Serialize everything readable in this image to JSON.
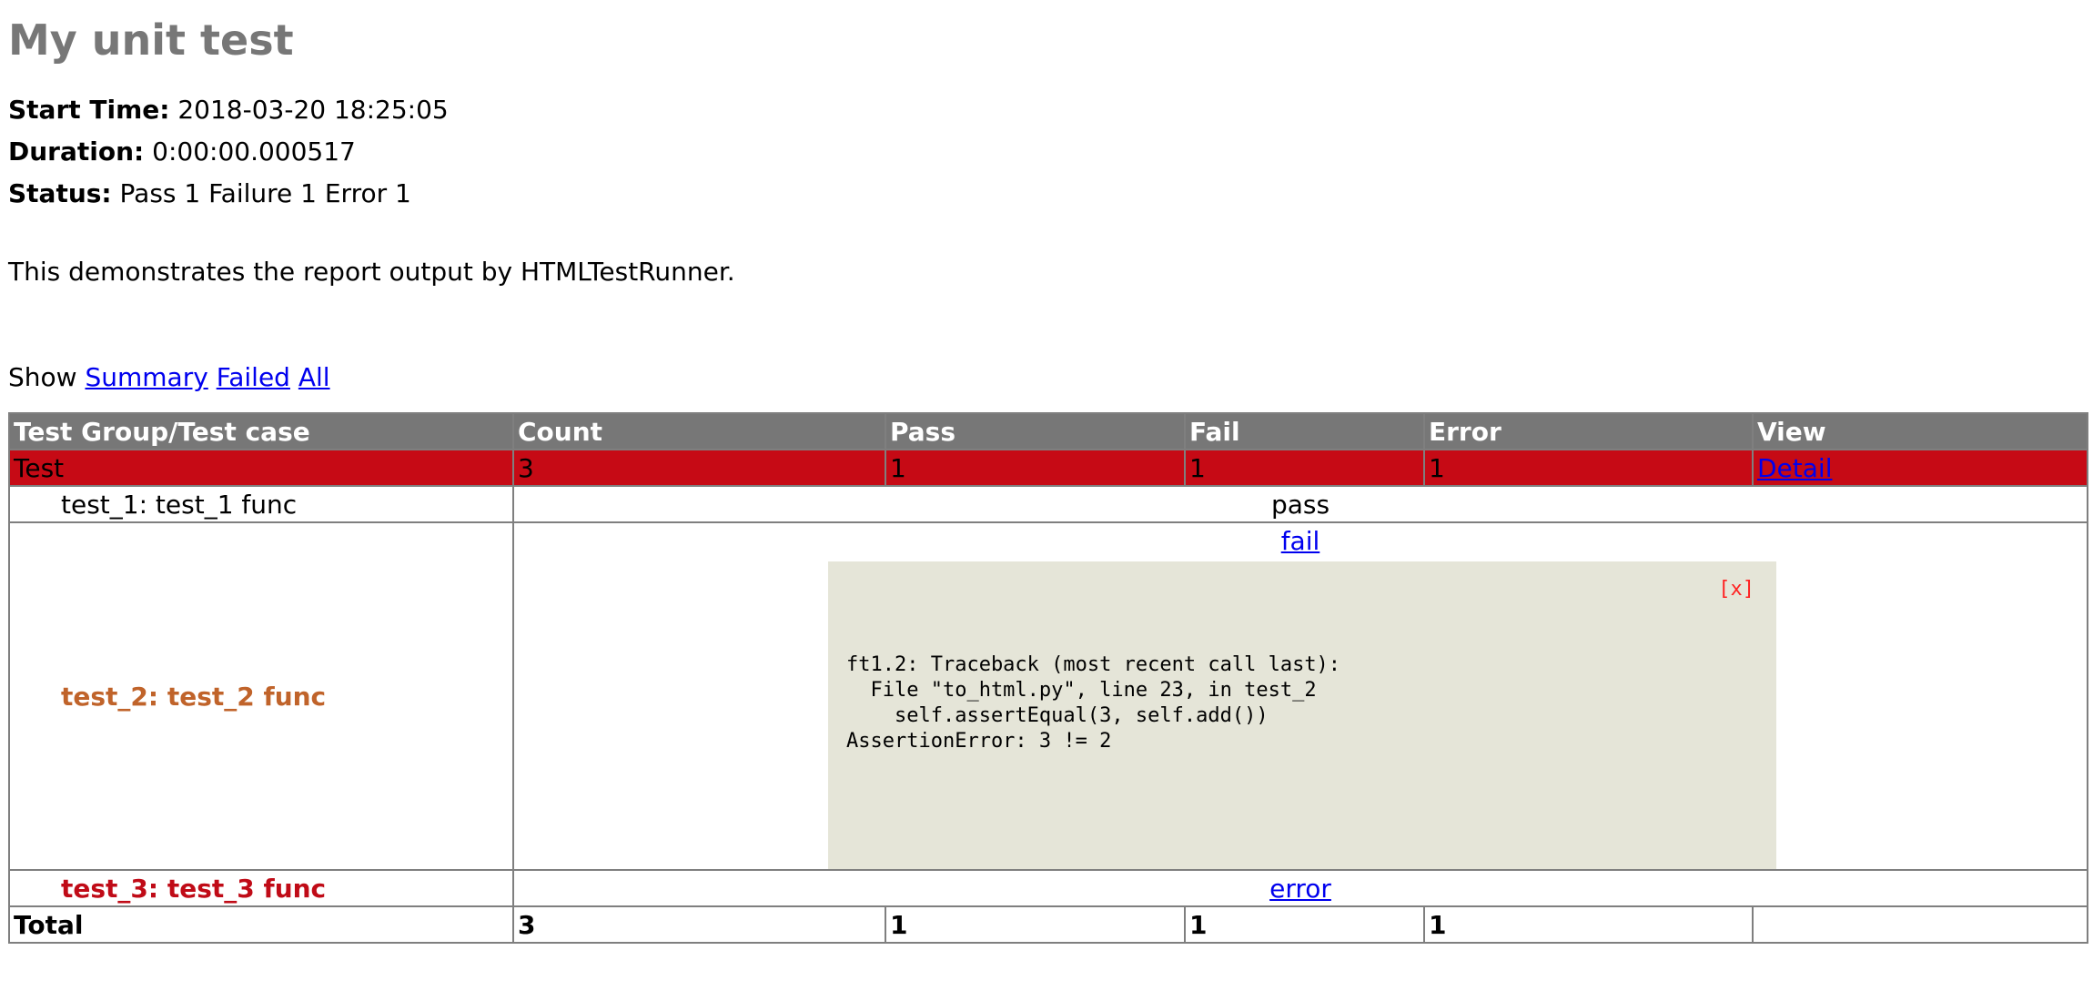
{
  "title": "My unit test",
  "attributes": {
    "start_time": {
      "label": "Start Time:",
      "value": "2018-03-20 18:25:05"
    },
    "duration": {
      "label": "Duration:",
      "value": "0:00:00.000517"
    },
    "status": {
      "label": "Status:",
      "value": "Pass 1 Failure 1 Error 1"
    }
  },
  "description": "This demonstrates the report output by HTMLTestRunner.",
  "show": {
    "label": "Show",
    "summary": "Summary",
    "failed": "Failed",
    "all": "All"
  },
  "table": {
    "headers": [
      "Test Group/Test case",
      "Count",
      "Pass",
      "Fail",
      "Error",
      "View"
    ],
    "group": {
      "name": "Test",
      "count": "3",
      "pass": "1",
      "fail": "1",
      "error": "1",
      "view": "Detail"
    },
    "cases": [
      {
        "name": "test_1: test_1 func",
        "status": "pass"
      },
      {
        "name": "test_2: test_2 func",
        "status": "fail",
        "close": "[x]",
        "traceback": "ft1.2: Traceback (most recent call last):\n  File \"to_html.py\", line 23, in test_2\n    self.assertEqual(3, self.add())\nAssertionError: 3 != 2"
      },
      {
        "name": "test_3: test_3 func",
        "status": "error"
      }
    ],
    "total": {
      "label": "Total",
      "count": "3",
      "pass": "1",
      "fail": "1",
      "error": "1"
    }
  },
  "colors": {
    "header_bg": "#777777",
    "fail_row_bg": "#c60a15",
    "fail_case_text": "#c0632a",
    "error_case_text": "#c00b17",
    "popup_bg": "#e5e5d8"
  }
}
